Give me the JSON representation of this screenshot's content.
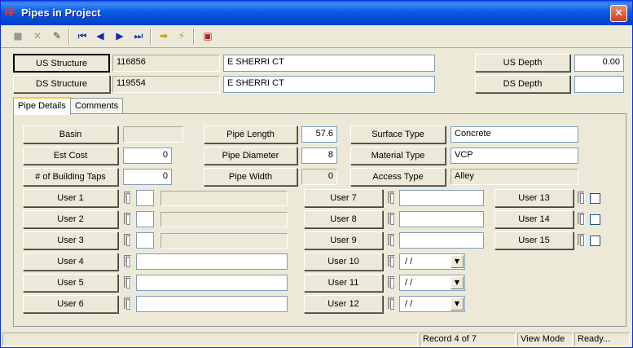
{
  "window": {
    "title": "Pipes in Project",
    "app_icon": "RF",
    "close_glyph": "✕"
  },
  "toolbar": {
    "icons": {
      "save": "floppy-disk-icon",
      "cancel": "x-icon",
      "edit": "pencil-icon",
      "first": "first-record-icon",
      "prev": "prev-record-icon",
      "next": "next-record-icon",
      "last": "last-record-icon",
      "goto": "arrow-right-icon",
      "lightning": "lightning-icon",
      "print": "print-icon"
    },
    "glyphs": {
      "save": "■",
      "cancel": "✕",
      "edit": "✎",
      "first": "⏮",
      "prev": "◀",
      "next": "▶",
      "last": "⏭",
      "goto": "➡",
      "lightning": "⚡",
      "print": "▣"
    }
  },
  "header": {
    "us_structure_label": "US Structure",
    "us_structure_id": "116856",
    "us_structure_street": "E  SHERRI CT",
    "ds_structure_label": "DS Structure",
    "ds_structure_id": "119554",
    "ds_structure_street": "E  SHERRI CT",
    "us_depth_label": "US Depth",
    "us_depth_value": "0.00",
    "ds_depth_label": "DS Depth",
    "ds_depth_value": ""
  },
  "tabs": [
    {
      "label": "Pipe Details"
    },
    {
      "label": "Comments"
    }
  ],
  "details": {
    "basin_label": "Basin",
    "basin_value": "",
    "est_cost_label": "Est Cost",
    "est_cost_value": "0",
    "building_taps_label": "# of Building Taps",
    "building_taps_value": "0",
    "pipe_length_label": "Pipe Length",
    "pipe_length_value": "57.6",
    "pipe_diameter_label": "Pipe Diameter",
    "pipe_diameter_value": "8",
    "pipe_width_label": "Pipe Width",
    "pipe_width_value": "0",
    "surface_type_label": "Surface Type",
    "surface_type_value": "Concrete",
    "material_type_label": "Material Type",
    "material_type_value": "VCP",
    "access_type_label": "Access Type",
    "access_type_value": "Alley"
  },
  "user_fields": {
    "u1": "User 1",
    "u2": "User 2",
    "u3": "User 3",
    "u4": "User 4",
    "u5": "User 5",
    "u6": "User 6",
    "u7": "User 7",
    "u8": "User 8",
    "u9": "User 9",
    "u10": "User 10",
    "u11": "User 11",
    "u12": "User 12",
    "u13": "User 13",
    "u14": "User 14",
    "u15": "User 15",
    "date_placeholder": " /  /",
    "dropdown_glyph": "▼"
  },
  "status": {
    "blank": "",
    "record": "Record 4 of 7",
    "mode": "View Mode",
    "state": "Ready..."
  }
}
